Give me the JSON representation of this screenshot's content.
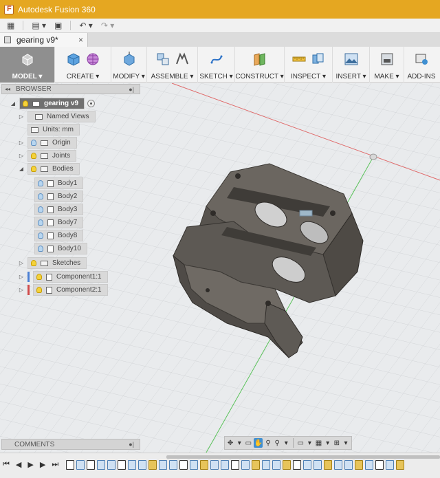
{
  "window": {
    "title": "Autodesk Fusion 360"
  },
  "document_tab": {
    "label": "gearing v9*"
  },
  "ribbon": {
    "groups": [
      {
        "label": "MODEL ▾"
      },
      {
        "label": "CREATE ▾"
      },
      {
        "label": "MODIFY ▾"
      },
      {
        "label": "ASSEMBLE ▾"
      },
      {
        "label": "SKETCH ▾"
      },
      {
        "label": "CONSTRUCT ▾"
      },
      {
        "label": "INSPECT ▾"
      },
      {
        "label": "INSERT ▾"
      },
      {
        "label": "MAKE ▾"
      },
      {
        "label": "ADD-INS"
      }
    ]
  },
  "browser": {
    "title": "BROWSER",
    "root": "gearing v9",
    "named_views": "Named Views",
    "units": "Units: mm",
    "origin": "Origin",
    "joints": "Joints",
    "bodies": "Bodies",
    "body_items": [
      "Body1",
      "Body2",
      "Body3",
      "Body7",
      "Body8",
      "Body10"
    ],
    "sketches": "Sketches",
    "components": [
      {
        "label": "Component1:1",
        "color": "#4a7fd4"
      },
      {
        "label": "Component2:1",
        "color": "#d04a4a"
      }
    ]
  },
  "comments": {
    "title": "COMMENTS"
  },
  "colors": {
    "title_bar": "#e5a721",
    "model_group": "#8f8f8f",
    "part_face": "#6b6660",
    "part_side": "#4e4a45"
  }
}
